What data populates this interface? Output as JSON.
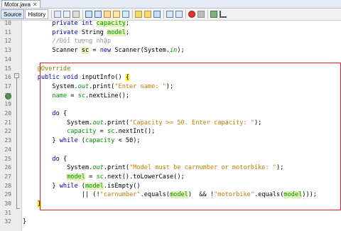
{
  "tab": {
    "title": "Motor.java",
    "close": "✕"
  },
  "toolbar": {
    "source": "Source",
    "history": "History"
  },
  "lines": [
    {
      "n": "10",
      "tokens": [
        {
          "t": "        "
        },
        {
          "t": "private int ",
          "c": "kw"
        },
        {
          "t": "capacity",
          "c": "fld hl"
        },
        {
          "t": ";"
        }
      ]
    },
    {
      "n": "11",
      "tokens": [
        {
          "t": "        "
        },
        {
          "t": "private ",
          "c": "kw"
        },
        {
          "t": "String "
        },
        {
          "t": "model",
          "c": "fld hl"
        },
        {
          "t": ";"
        }
      ]
    },
    {
      "n": "12",
      "tokens": [
        {
          "t": "        "
        },
        {
          "t": "//Đổi tượng nhập",
          "c": "cmt"
        }
      ]
    },
    {
      "n": "13",
      "tokens": [
        {
          "t": "        Scanner "
        },
        {
          "t": "sc",
          "c": "hl"
        },
        {
          "t": " = "
        },
        {
          "t": "new ",
          "c": "kw"
        },
        {
          "t": "Scanner(System."
        },
        {
          "t": "in",
          "c": "fld it"
        },
        {
          "t": ");"
        }
      ]
    },
    {
      "n": "14",
      "tokens": []
    },
    {
      "n": "15",
      "tokens": [
        {
          "t": "    "
        },
        {
          "t": "@Override",
          "c": "ann"
        }
      ]
    },
    {
      "n": "16",
      "tokens": [
        {
          "t": "    "
        },
        {
          "t": "public void ",
          "c": "kw"
        },
        {
          "t": "inputInfo() "
        },
        {
          "t": "{",
          "c": "curbrace"
        }
      ]
    },
    {
      "n": "17",
      "tokens": [
        {
          "t": "        System."
        },
        {
          "t": "out",
          "c": "fld it"
        },
        {
          "t": ".print("
        },
        {
          "t": "\"Enter name: \"",
          "c": "str"
        },
        {
          "t": ");"
        }
      ]
    },
    {
      "n": "18",
      "tokens": [
        {
          "t": "        "
        },
        {
          "t": "name",
          "c": "fld"
        },
        {
          "t": " = "
        },
        {
          "t": "sc",
          "c": "fld"
        },
        {
          "t": ".nextLine();"
        }
      ]
    },
    {
      "n": "19",
      "tokens": []
    },
    {
      "n": "20",
      "tokens": [
        {
          "t": "        "
        },
        {
          "t": "do ",
          "c": "kw"
        },
        {
          "t": "{"
        }
      ]
    },
    {
      "n": "21",
      "tokens": [
        {
          "t": "            System."
        },
        {
          "t": "out",
          "c": "fld it"
        },
        {
          "t": ".print("
        },
        {
          "t": "\"Capacity >= 50. Enter capacity: \"",
          "c": "str"
        },
        {
          "t": ");"
        }
      ]
    },
    {
      "n": "22",
      "tokens": [
        {
          "t": "            "
        },
        {
          "t": "capacity",
          "c": "fld"
        },
        {
          "t": " = "
        },
        {
          "t": "sc",
          "c": "fld"
        },
        {
          "t": ".nextInt();"
        }
      ]
    },
    {
      "n": "23",
      "tokens": [
        {
          "t": "        } "
        },
        {
          "t": "while ",
          "c": "kw"
        },
        {
          "t": "("
        },
        {
          "t": "capacity",
          "c": "fld"
        },
        {
          "t": " < 50);"
        }
      ]
    },
    {
      "n": "24",
      "tokens": []
    },
    {
      "n": "25",
      "tokens": [
        {
          "t": "        "
        },
        {
          "t": "do ",
          "c": "kw"
        },
        {
          "t": "{"
        }
      ]
    },
    {
      "n": "26",
      "tokens": [
        {
          "t": "            System."
        },
        {
          "t": "out",
          "c": "fld it"
        },
        {
          "t": ".print("
        },
        {
          "t": "\"Model must be carnumber or motorbike: \"",
          "c": "str"
        },
        {
          "t": ");"
        }
      ]
    },
    {
      "n": "27",
      "tokens": [
        {
          "t": "            "
        },
        {
          "t": "model",
          "c": "fld hl"
        },
        {
          "t": " = "
        },
        {
          "t": "sc",
          "c": "fld"
        },
        {
          "t": ".next().toLowerCase();"
        }
      ]
    },
    {
      "n": "28",
      "tokens": [
        {
          "t": "        } "
        },
        {
          "t": "while ",
          "c": "kw"
        },
        {
          "t": "("
        },
        {
          "t": "model",
          "c": "fld hl"
        },
        {
          "t": ".isEmpty()"
        }
      ]
    },
    {
      "n": "29",
      "tokens": [
        {
          "t": "                || (!"
        },
        {
          "t": "\"carnumber\"",
          "c": "str"
        },
        {
          "t": ".equals("
        },
        {
          "t": "model",
          "c": "fld hl"
        },
        {
          "t": ")  && !"
        },
        {
          "t": "\"motorbike\"",
          "c": "str"
        },
        {
          "t": ".equals("
        },
        {
          "t": "model",
          "c": "fld hl"
        },
        {
          "t": ")));"
        }
      ]
    },
    {
      "n": "30",
      "tokens": [
        {
          "t": "    "
        },
        {
          "t": "}",
          "c": "curbrace"
        }
      ]
    },
    {
      "n": "31",
      "tokens": []
    },
    {
      "n": "32",
      "tokens": [
        {
          "t": "}"
        }
      ]
    }
  ]
}
